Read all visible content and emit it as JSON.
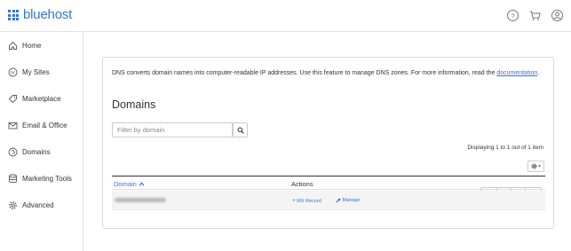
{
  "brand": {
    "name": "bluehost",
    "accent": "#3575d3"
  },
  "topbar": {
    "icons": [
      "help-icon",
      "cart-icon",
      "user-icon"
    ]
  },
  "sidebar": {
    "items": [
      {
        "label": "Home",
        "icon": "home-icon"
      },
      {
        "label": "My Sites",
        "icon": "wordpress-icon"
      },
      {
        "label": "Marketplace",
        "icon": "tag-icon"
      },
      {
        "label": "Email & Office",
        "icon": "mail-icon"
      },
      {
        "label": "Domains",
        "icon": "globe-icon"
      },
      {
        "label": "Marketing Tools",
        "icon": "marketing-icon"
      },
      {
        "label": "Advanced",
        "icon": "gear-icon"
      }
    ]
  },
  "main": {
    "intro_text": "DNS converts domain names into computer-readable IP addresses. Use this feature to manage DNS zones. For more information, read the",
    "intro_link": "documentation",
    "intro_end": ".",
    "title": "Domains",
    "filter_placeholder": "Filter by domain",
    "pager": [
      "<<",
      "<",
      ">",
      ">>"
    ],
    "displaying": "Displaying 1 to 1 out of 1 item",
    "table": {
      "col_domain": "Domain",
      "col_actions": "Actions",
      "row_actions": {
        "mx_record": "MX Record",
        "manage": "Manage"
      }
    }
  }
}
